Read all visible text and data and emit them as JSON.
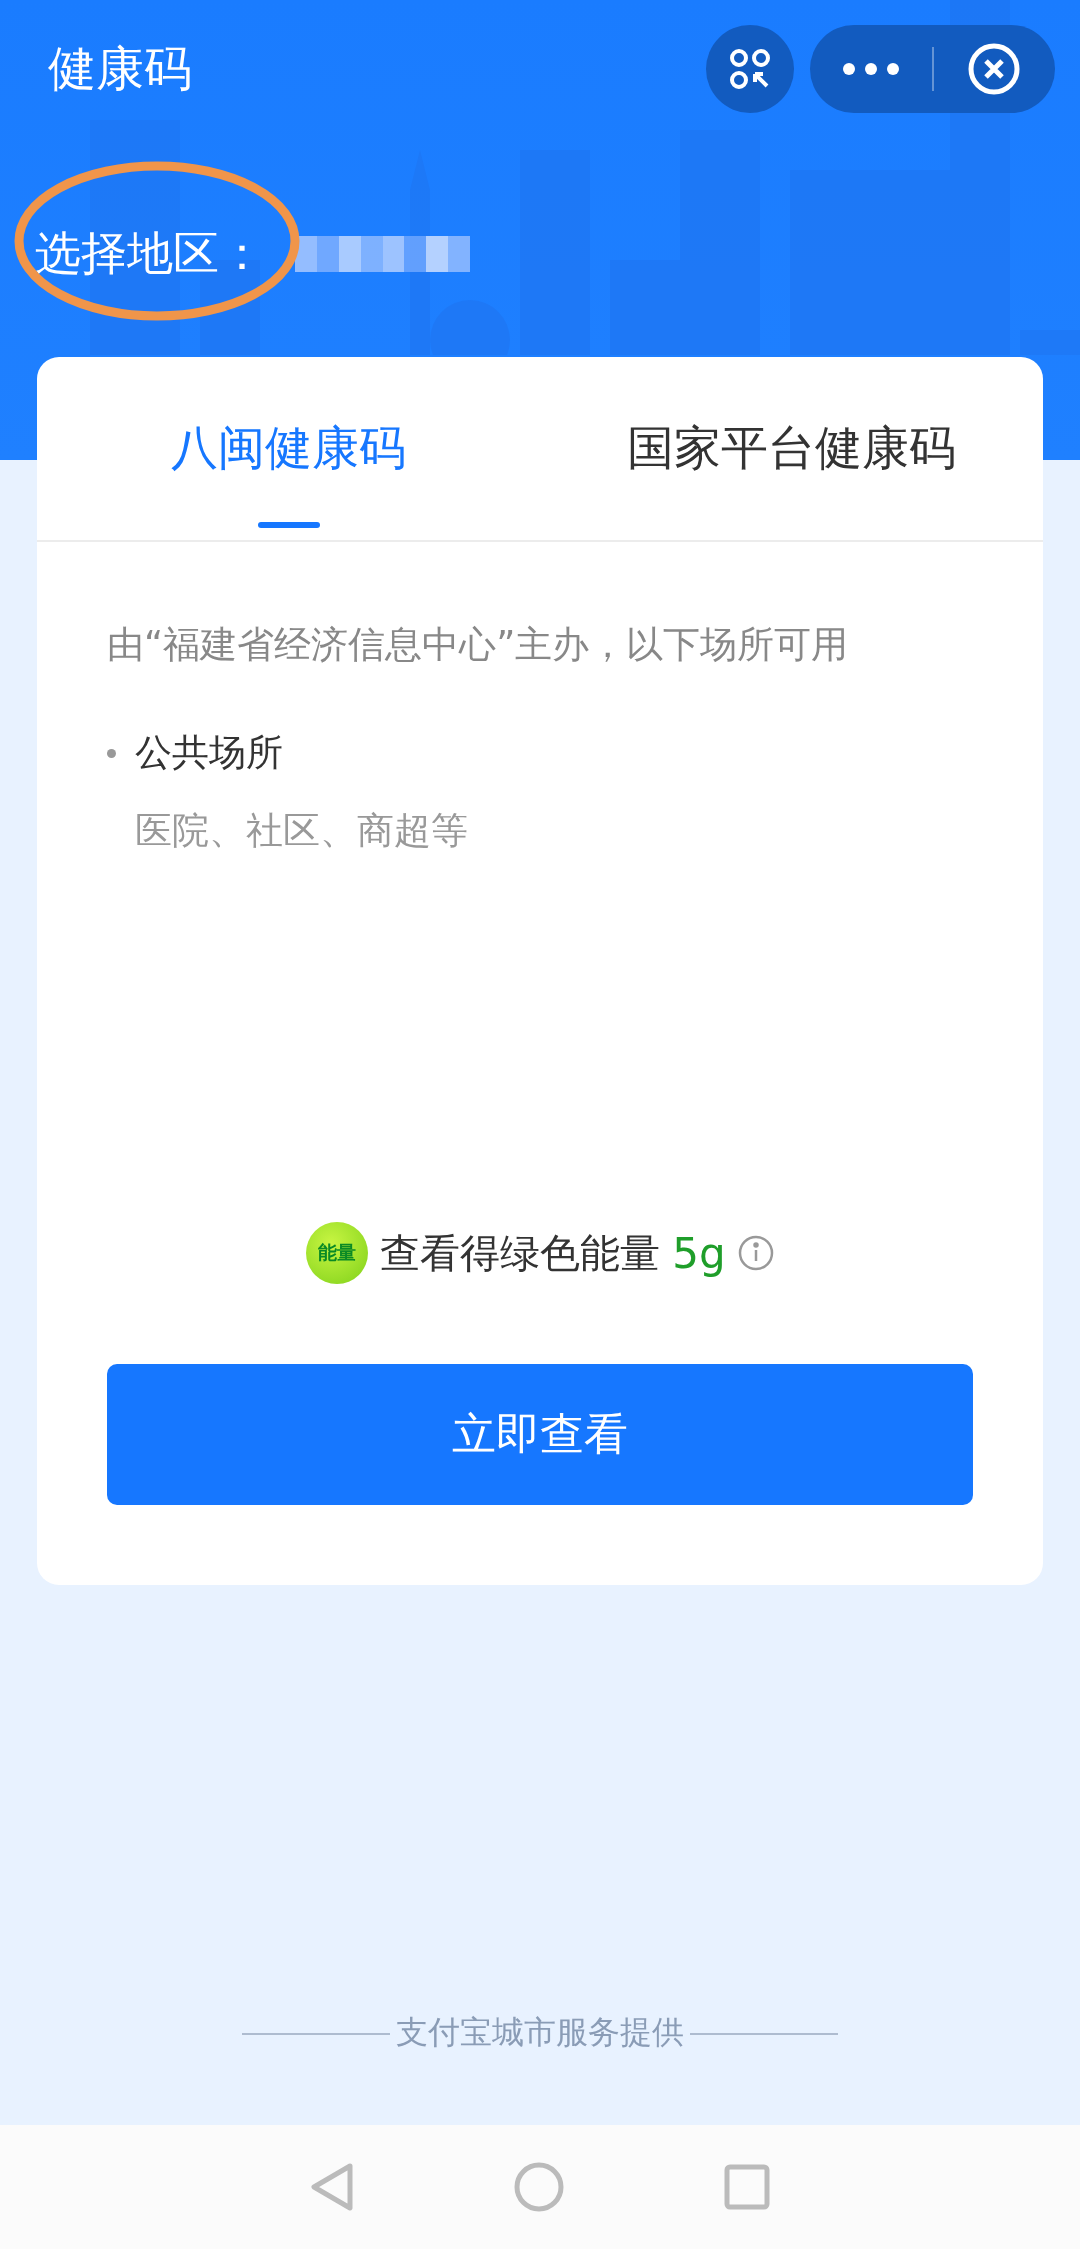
{
  "header": {
    "title": "健康码",
    "region_label": "选择地区："
  },
  "tabs": [
    {
      "label": "八闽健康码",
      "selected": true
    },
    {
      "label": "国家平台健康码",
      "selected": false
    }
  ],
  "description": "由“福建省经济信息中心”主办，以下场所可用",
  "places": [
    {
      "title": "公共场所",
      "detail": "医院、社区、商超等"
    }
  ],
  "energy": {
    "badge": "能量",
    "text": "查看得绿色能量",
    "amount": "5g"
  },
  "button": "立即查看",
  "footer": "支付宝城市服务提供"
}
